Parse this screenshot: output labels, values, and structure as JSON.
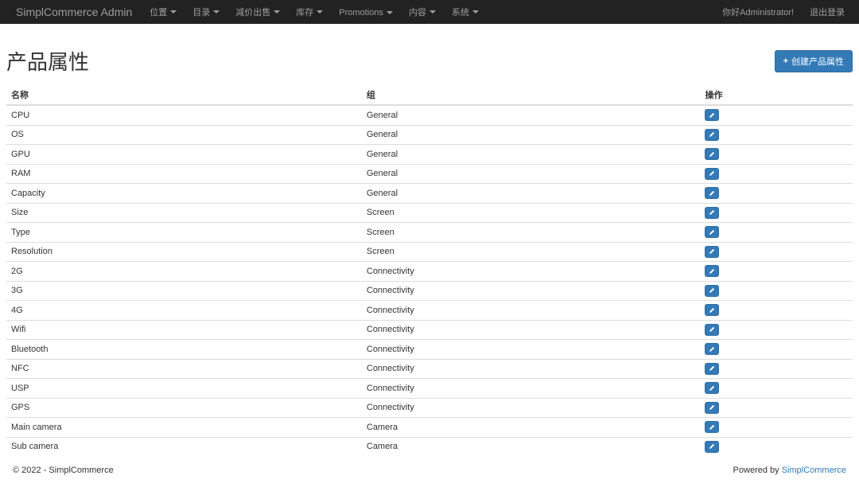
{
  "navbar": {
    "brand": "SimplCommerce Admin",
    "left_items": [
      {
        "label": "位置",
        "has_caret": true
      },
      {
        "label": "目录",
        "has_caret": true
      },
      {
        "label": "减价出售",
        "has_caret": true
      },
      {
        "label": "库存",
        "has_caret": true
      },
      {
        "label": "Promotions",
        "has_caret": true
      },
      {
        "label": "内容",
        "has_caret": true
      },
      {
        "label": "系统",
        "has_caret": true
      }
    ],
    "right_items": [
      {
        "label": "你好Administrator!"
      },
      {
        "label": "退出登录"
      }
    ]
  },
  "page": {
    "title": "产品属性",
    "create_button": "创建产品属性"
  },
  "table": {
    "headers": {
      "name": "名称",
      "group": "组",
      "actions": "操作"
    },
    "rows": [
      {
        "name": "CPU",
        "group": "General"
      },
      {
        "name": "OS",
        "group": "General"
      },
      {
        "name": "GPU",
        "group": "General"
      },
      {
        "name": "RAM",
        "group": "General"
      },
      {
        "name": "Capacity",
        "group": "General"
      },
      {
        "name": "Size",
        "group": "Screen"
      },
      {
        "name": "Type",
        "group": "Screen"
      },
      {
        "name": "Resolution",
        "group": "Screen"
      },
      {
        "name": "2G",
        "group": "Connectivity"
      },
      {
        "name": "3G",
        "group": "Connectivity"
      },
      {
        "name": "4G",
        "group": "Connectivity"
      },
      {
        "name": "Wifi",
        "group": "Connectivity"
      },
      {
        "name": "Bluetooth",
        "group": "Connectivity"
      },
      {
        "name": "NFC",
        "group": "Connectivity"
      },
      {
        "name": "USP",
        "group": "Connectivity"
      },
      {
        "name": "GPS",
        "group": "Connectivity"
      },
      {
        "name": "Main camera",
        "group": "Camera"
      },
      {
        "name": "Sub camera",
        "group": "Camera"
      }
    ]
  },
  "footer": {
    "copyright": "© 2022 - SimplCommerce",
    "powered_by_label": "Powered by ",
    "powered_by_link": "SimplCommerce"
  }
}
